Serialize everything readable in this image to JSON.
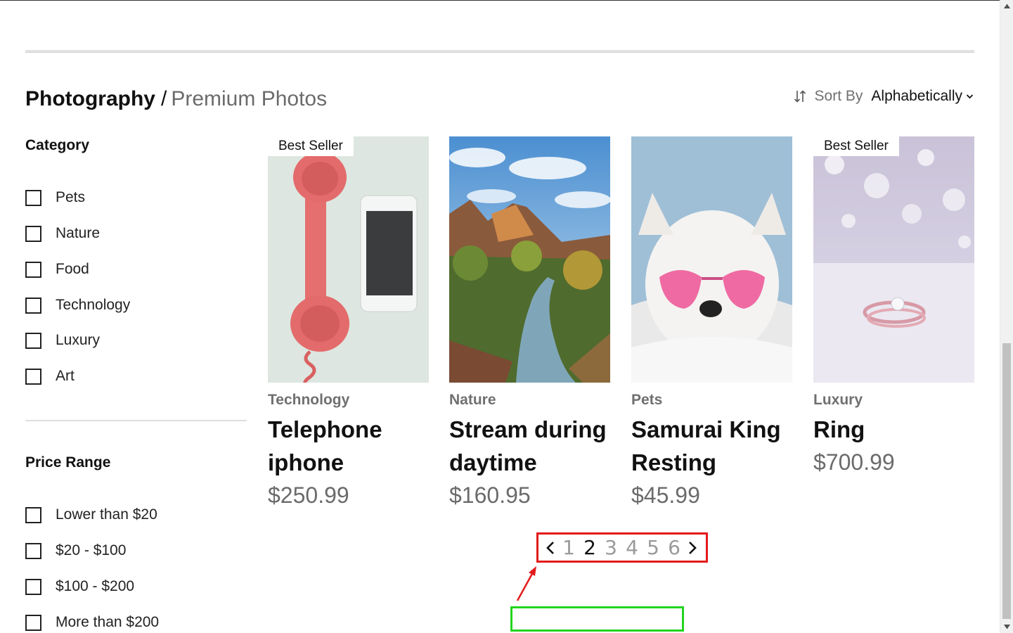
{
  "breadcrumb": {
    "main": "Photography",
    "separator": "/",
    "sub": "Premium Photos"
  },
  "sort": {
    "label": "Sort By",
    "value": "Alphabetically"
  },
  "filters": {
    "category": {
      "title": "Category",
      "options": [
        "Pets",
        "Nature",
        "Food",
        "Technology",
        "Luxury",
        "Art"
      ]
    },
    "price": {
      "title": "Price Range",
      "options": [
        "Lower than $20",
        "$20 - $100",
        "$100 - $200",
        "More than $200"
      ]
    }
  },
  "products": [
    {
      "badge": "Best Seller",
      "category": "Technology",
      "title_line1": "Telephone",
      "title_line2": "iphone",
      "price": "$250.99",
      "image": "red-telephone-and-phone"
    },
    {
      "badge": "",
      "category": "Nature",
      "title_line1": "Stream during",
      "title_line2": "daytime",
      "price": "$160.95",
      "image": "canyon-river"
    },
    {
      "badge": "",
      "category": "Pets",
      "title_line1": "Samurai King",
      "title_line2": "Resting",
      "price": "$45.99",
      "image": "white-dog-pink-glasses"
    },
    {
      "badge": "Best Seller",
      "category": "Luxury",
      "title_line1": "Ring",
      "title_line2": "",
      "price": "$700.99",
      "image": "diamond-ring-bokeh"
    }
  ],
  "pagination": {
    "pages": [
      "1",
      "2",
      "3",
      "4",
      "5",
      "6"
    ],
    "current": "2"
  },
  "colors": {
    "annotation_red": "#e31b1b",
    "annotation_green": "#22d41e",
    "price_gray": "#6b6b6b"
  }
}
